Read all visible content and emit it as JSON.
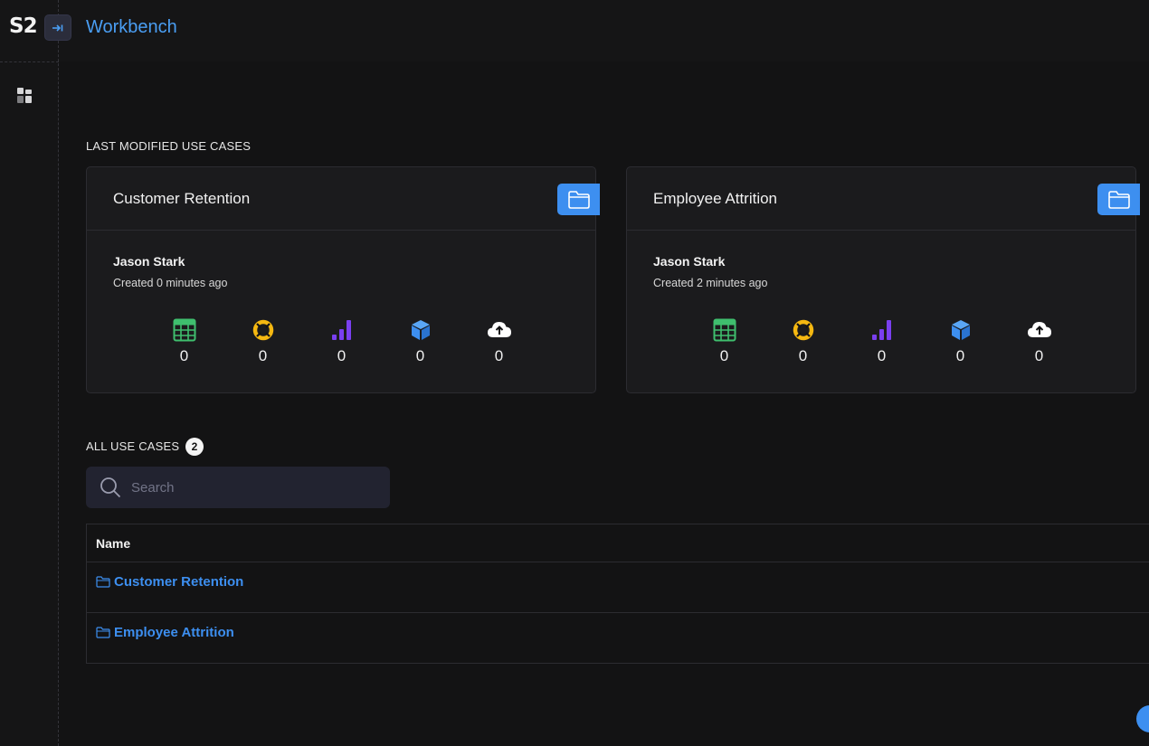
{
  "app": {
    "logo": "S2",
    "title": "Workbench"
  },
  "last_modified": {
    "heading": "LAST MODIFIED USE CASES",
    "cards": [
      {
        "title": "Customer Retention",
        "owner": "Jason Stark",
        "created": "Created 0 minutes ago",
        "stats": [
          {
            "icon": "table-icon",
            "value": "0"
          },
          {
            "icon": "lifebuoy-icon",
            "value": "0"
          },
          {
            "icon": "bar-chart-icon",
            "value": "0"
          },
          {
            "icon": "cube-icon",
            "value": "0"
          },
          {
            "icon": "cloud-upload-icon",
            "value": "0"
          }
        ]
      },
      {
        "title": "Employee Attrition",
        "owner": "Jason Stark",
        "created": "Created 2 minutes ago",
        "stats": [
          {
            "icon": "table-icon",
            "value": "0"
          },
          {
            "icon": "lifebuoy-icon",
            "value": "0"
          },
          {
            "icon": "bar-chart-icon",
            "value": "0"
          },
          {
            "icon": "cube-icon",
            "value": "0"
          },
          {
            "icon": "cloud-upload-icon",
            "value": "0"
          }
        ]
      }
    ]
  },
  "all_use_cases": {
    "heading": "ALL USE CASES",
    "count": "2",
    "search_placeholder": "Search",
    "table": {
      "columns": [
        "Name"
      ],
      "rows": [
        {
          "name": "Customer Retention"
        },
        {
          "name": "Employee Attrition"
        }
      ]
    }
  },
  "colors": {
    "accent": "#3d8ff0",
    "title_blue": "#4a9ef3",
    "table_icon": "#3fbf6e",
    "lifebuoy_icon": "#f5b811",
    "bar_icon": "#7a3ff0",
    "cube_icon": "#3d8ff0",
    "cloud_icon": "#ffffff"
  }
}
